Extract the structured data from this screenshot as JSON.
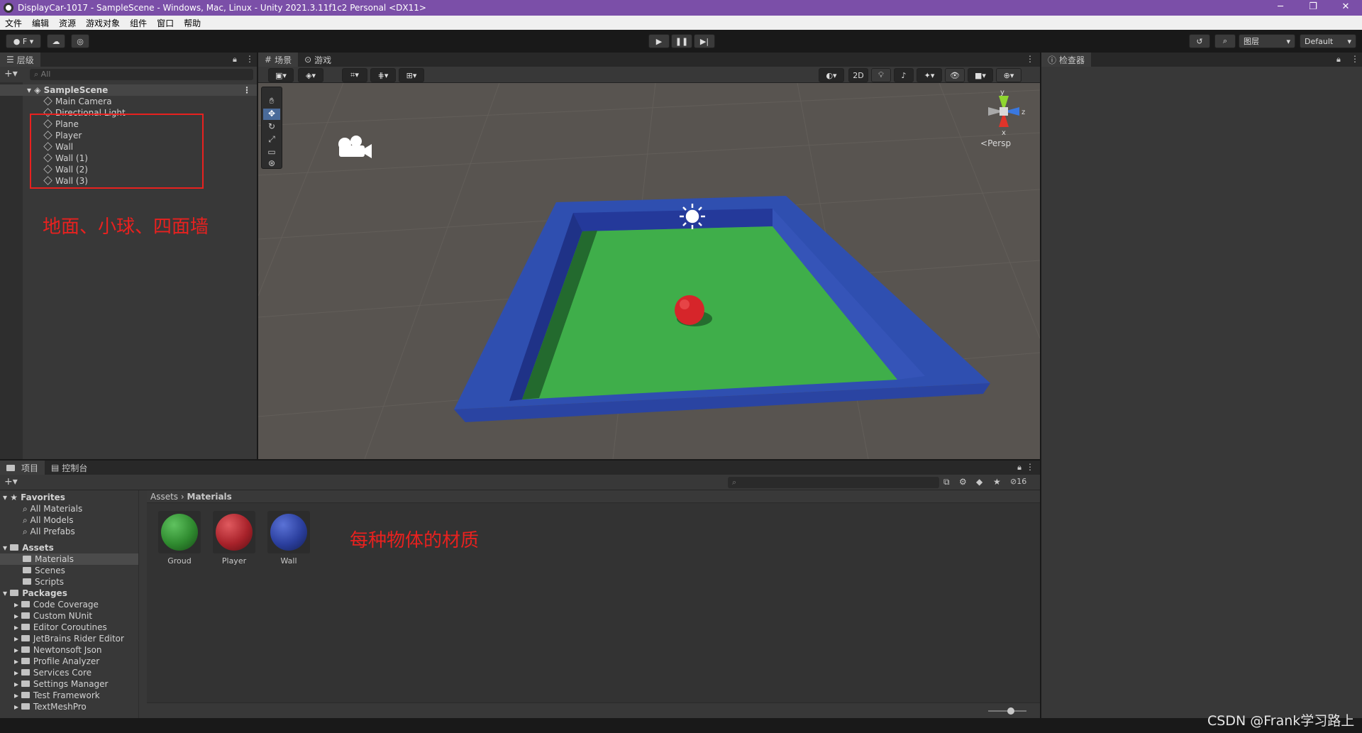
{
  "window": {
    "title": "DisplayCar-1017 - SampleScene - Windows, Mac, Linux - Unity 2021.3.11f1c2 Personal <DX11>",
    "min": "─",
    "max": "❐",
    "close": "✕"
  },
  "menu": [
    "文件",
    "编辑",
    "资源",
    "游戏对象",
    "组件",
    "窗口",
    "帮助"
  ],
  "toolbar": {
    "account": "F",
    "layers_label": "图层",
    "layout_label": "Default"
  },
  "hierarchy": {
    "tab": "层级",
    "search_placeholder": "All",
    "scene_name": "SampleScene",
    "items": [
      "Main Camera",
      "Directional Light",
      "Plane",
      "Player",
      "Wall",
      "Wall (1)",
      "Wall (2)",
      "Wall (3)"
    ],
    "annotation": "地面、小球、四面墙"
  },
  "scene": {
    "tabs": [
      "场景",
      "游戏"
    ],
    "persp_label": "Persp",
    "mode_2d": "2D",
    "gizmo_axes": {
      "y": "y",
      "z": "z",
      "x": "x"
    }
  },
  "inspector": {
    "tab": "检查器"
  },
  "project": {
    "tabs": [
      "项目",
      "控制台"
    ],
    "hidden_count": "16",
    "breadcrumb": [
      "Assets",
      "Materials"
    ],
    "tree": {
      "favorites_label": "Favorites",
      "favorites": [
        "All Materials",
        "All Models",
        "All Prefabs"
      ],
      "assets_label": "Assets",
      "assets": [
        "Materials",
        "Scenes",
        "Scripts"
      ],
      "packages_label": "Packages",
      "packages": [
        "Code Coverage",
        "Custom NUnit",
        "Editor Coroutines",
        "JetBrains Rider Editor",
        "Newtonsoft Json",
        "Profile Analyzer",
        "Services Core",
        "Settings Manager",
        "Test Framework",
        "TextMeshPro"
      ]
    },
    "materials": [
      {
        "name": "Groud",
        "color": "#2f8a2f"
      },
      {
        "name": "Player",
        "color": "#a8222a"
      },
      {
        "name": "Wall",
        "color": "#2b3f9e"
      }
    ],
    "annotation": "每种物体的材质"
  },
  "watermark": "CSDN @Frank学习路上",
  "colors": {
    "floor": "#3fae4a",
    "wall": "#2f4fb0",
    "ball": "#d6252a",
    "title_bar": "#7b4fa8"
  }
}
